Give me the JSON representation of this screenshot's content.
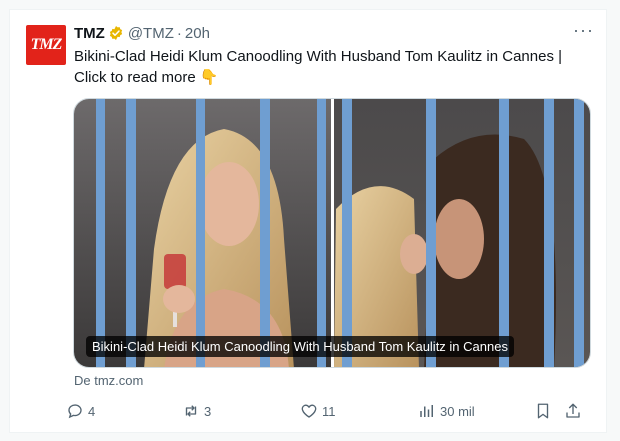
{
  "tweet": {
    "author_name": "TMZ",
    "author_handle": "@TMZ",
    "separator": "·",
    "time": "20h",
    "avatar_text": "TMZ",
    "more_label": "···",
    "text": "Bikini-Clad Heidi Klum Canoodling With Husband Tom Kaulitz in Cannes   |  Click to read more",
    "emoji": "👇",
    "card_caption": "Bikini-Clad Heidi Klum Canoodling With Husband Tom Kaulitz in Cannes",
    "source": "De tmz.com"
  },
  "actions": {
    "replies": "4",
    "reposts": "3",
    "likes": "11",
    "views": "30 mil"
  },
  "colors": {
    "brand": "#e2231a",
    "verified": "#e8b600",
    "muted": "#536471"
  },
  "icons": [
    "verified-badge-icon",
    "more-icon",
    "reply-icon",
    "repost-icon",
    "like-icon",
    "views-icon",
    "bookmark-icon",
    "share-icon"
  ]
}
